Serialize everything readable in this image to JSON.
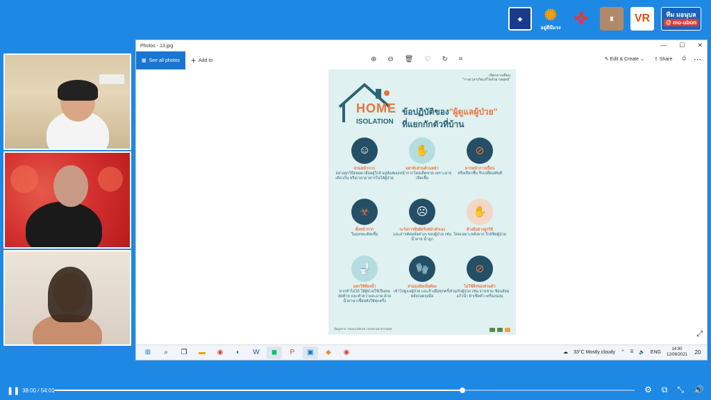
{
  "logos": [
    "Department logo",
    "อยู่ดีมีแรง",
    "network-icon",
    "sculpture-logo",
    "VR",
    "ทีม มอนุบล mo-ubon"
  ],
  "logo_texts": {
    "l2": "อยู่ดีมีแรง",
    "l5": "VR",
    "l6_top": "ทีม มอนุบล",
    "l6_bottom": "@ mo-ubon"
  },
  "window": {
    "title": "Photos - 13.jpg",
    "controls": [
      "—",
      "☐",
      "✕"
    ],
    "see_all": "See all photos",
    "add_to": "Add to",
    "edit_create": "Edit & Create",
    "share": "Share"
  },
  "poster": {
    "tag_line1": "เปิดกลางเดือน",
    "tag_line2": "\"กาลเวลาเกิดแก้ไขด้วย กลยุทธ์\"",
    "home": "HOME",
    "isolation": "ISOLATION",
    "title_prefix": "ข้อปฏิบัติของ",
    "title_highlight": "\"ผู้ดูแลผู้ป่วย\"",
    "title_line2": "ที่แยกกักตัวที่บ้าน",
    "items": [
      {
        "bold": "สวมหน้ากาก",
        "rest": "อย่างถูกวิธีตลอด เมื่ออยู่ใกล้ อยู่ห้องเดียวกัน หรือเวลาอาหารในให้ผู้ป่วย"
      },
      {
        "bold": "อย่าจับส่วนด้านหน้า",
        "rest": "ของหน้ากากโดยเด็ดขาด เพราะอาจเปิดเชื้อ"
      },
      {
        "bold": "หากหน้ากากเปื้อน",
        "rest": "หรือเปียกชื้น รีบเปลี่ยนทันที"
      },
      {
        "bold": "ทิ้งหน้ากาก",
        "rest": "ในถุงขยะติดเชื้อ"
      },
      {
        "bold": "ระวังการสัมผัสใบหน้าตัวเอง",
        "rest": "และสารคัดหลั่งต่างๆ ของผู้ป่วย เช่น น้ำลาย น้ำมูก"
      },
      {
        "bold": "ล้างมือย่างถูกวิธี",
        "rest": "โดยเฉพาะหลังจาก ใกล้ชิดผู้ป่วย"
      },
      {
        "bold": "แยกใช้ห้องน้ำ",
        "rest": "หากทำไม่ได้ ให้ผู้ป่วยใช้เป็นคนสุดท้าย และทำความสะอาด ด้วยน้ำยาฆ่าเชื้อหลังใช้ทุกครั้ง"
      },
      {
        "bold": "สวมถุงมือเมื่อต้อง",
        "rest": "เข้าไปดูแลผู้ป่วย และล้างมือทุกครั้ง หลังถอดถุงมือ"
      },
      {
        "bold": "ไม่ใช้สิ่งของส่วนตัว",
        "rest": "ร่วมกับผู้ป่วย เช่น จานชาม ช้อนส้อม แก้วน้ำ ผ้าเช็ดตัว เครื่องนอน"
      }
    ],
    "footer": "ข้อมูลจาก: กรมอนามัย สถ. กระทรวงสาธารณสุข"
  },
  "taskbar": {
    "apps": [
      "windows-icon",
      "search-icon",
      "task-view-icon",
      "file-explorer-icon",
      "chrome-icon",
      "edge-icon",
      "word-icon",
      "line-icon",
      "powerpoint-icon",
      "photos-icon",
      "app-icon",
      "chrome-profile-icon"
    ],
    "weather_temp": "33°C",
    "weather_desc": "Mostly cloudy",
    "lang": "ENG",
    "time": "14:30",
    "date": "12/08/2021",
    "notif_count": "20"
  },
  "player": {
    "current": "38:00",
    "duration": "54:01",
    "progress": 0.703
  },
  "colors": {
    "background": "#1e88e5",
    "accent_orange": "#e8743b",
    "poster_teal": "#2a6378"
  }
}
